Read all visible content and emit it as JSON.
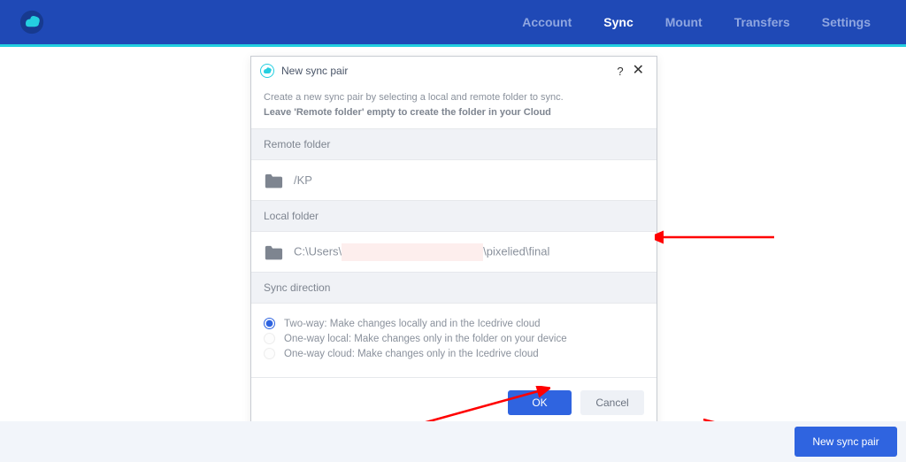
{
  "nav": {
    "items": [
      "Account",
      "Sync",
      "Mount",
      "Transfers",
      "Settings"
    ],
    "active_index": 1
  },
  "dialog": {
    "title": "New sync pair",
    "help_symbol": "?",
    "close_symbol": "✕",
    "instruction_line1": "Create a new sync pair by selecting a local and remote folder to sync.",
    "instruction_line2": "Leave 'Remote folder' empty to create the folder in your Cloud",
    "remote": {
      "header": "Remote folder",
      "path": "/KP"
    },
    "local": {
      "header": "Local folder",
      "path_prefix": "C:\\Users\\",
      "path_suffix": "\\pixelied\\final"
    },
    "sync_direction": {
      "header": "Sync direction",
      "options": [
        "Two-way: Make changes locally and in the Icedrive cloud",
        "One-way local: Make changes only in the folder on your device",
        "One-way cloud: Make changes only in the Icedrive cloud"
      ],
      "selected_index": 0
    },
    "buttons": {
      "ok": "OK",
      "cancel": "Cancel"
    }
  },
  "bottom_button": "New sync pair"
}
